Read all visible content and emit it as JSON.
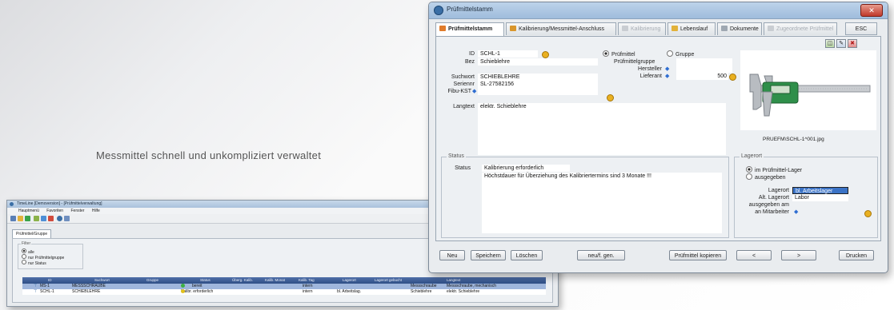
{
  "tagline": "Messmittel schnell und unkompliziert verwaltet",
  "main_window": {
    "title": "Prüfmittelstamm",
    "close_label": "✕",
    "tabs": [
      {
        "label": "Prüfmittelstamm",
        "active": true
      },
      {
        "label": "Kalibrierung/Messmittel-Anschluss",
        "active": false
      },
      {
        "label": "Kalibrierung",
        "disabled": true
      },
      {
        "label": "Lebenslauf",
        "active": false
      },
      {
        "label": "Dokumente",
        "active": false
      },
      {
        "label": "Zugeordnete Prüfmittel",
        "disabled": true
      }
    ],
    "esc_label": "ESC",
    "fields": {
      "id_label": "ID",
      "id_value": "SCHL-1",
      "bez_label": "Bez",
      "bez_value": "Schieblehre",
      "suchwort_label": "Suchwort",
      "suchwort_value": "SCHIEBLEHRE",
      "seriennr_label": "Seriennr",
      "seriennr_value": "SL-27582156",
      "fibu_label": "Fibu-KST",
      "langtext_label": "Langtext",
      "langtext_value": "elektr. Schieblehre"
    },
    "type_options": {
      "pruefmittel": "Prüfmittel",
      "gruppe": "Gruppe",
      "selected": "Prüfmittel"
    },
    "right_fields": {
      "gruppe_label": "Prüfmittelgruppe",
      "hersteller_label": "Hersteller",
      "lieferant_label": "Lieferant",
      "lieferant_value": "500"
    },
    "image_caption": "PRUEFM\\SCHL-1^001.jpg",
    "status_group": {
      "title": "Status",
      "status_label": "Status",
      "status_value": "Kalibrierung erforderlich",
      "note": "Höchstdauer für Überziehung des Kalibriertermins sind 3 Monate !!!"
    },
    "lagerort_group": {
      "title": "Lagerort",
      "opt_lager": "im Prüfmittel-Lager",
      "opt_ausgegeben": "ausgegeben",
      "selected": "im Prüfmittel-Lager",
      "lagerort_label": "Lagerort",
      "lagerort_value": "bl. Arbeitslager",
      "alt_label": "Alt. Lagerort",
      "alt_value": "Labor",
      "ausgegeben_am_label": "ausgegeben am",
      "an_mitarbeiter_label": "an Mitarbeiter"
    },
    "buttons": {
      "neu": "Neu",
      "speichern": "Speichern",
      "loeschen": "Löschen",
      "neufuer": "neu/f. gen.",
      "kopieren": "Prüfmittel kopieren",
      "prev": "<",
      "next": ">",
      "drucken": "Drucken"
    }
  },
  "small_window": {
    "title": "TimeLine [Demoversion] - [Prüfmittelverwaltung]",
    "menu": [
      "Hauptmenü",
      "Favoriten",
      "Fenster",
      "Hilfe"
    ],
    "tab": "Prüfmittel/Gruppe",
    "filter": {
      "title": "Filter",
      "options": [
        "alle",
        "nur Prüfmittelgruppe",
        "nur Status"
      ],
      "selected": "alle"
    },
    "columns": [
      "ID",
      "Suchwort",
      "Gruppe",
      "Status",
      "Überg. Kalib.",
      "Kalib. Monat",
      "Kalib. Tag",
      "Lagerort",
      "Lagerort gebucht",
      "Langtext",
      "Bez"
    ],
    "rows": [
      {
        "id": "MS-1",
        "suchwort": "MESSSCHRAUBE",
        "status": "bereit",
        "status_color": "#3cb043",
        "intern": "intern",
        "lagerort": "",
        "bez": "Messschraube",
        "langtext": "Messschraube, mechanisch"
      },
      {
        "id": "SCHL-1",
        "suchwort": "SCHIEBLEHRE",
        "status": "Kalibr. erforderlich",
        "status_color": "#e2c11b",
        "intern": "intern",
        "lagerort": "bl. Arbeitslag.",
        "bez": "Schieblehre",
        "langtext": "elektr. Schieblehre"
      }
    ]
  }
}
